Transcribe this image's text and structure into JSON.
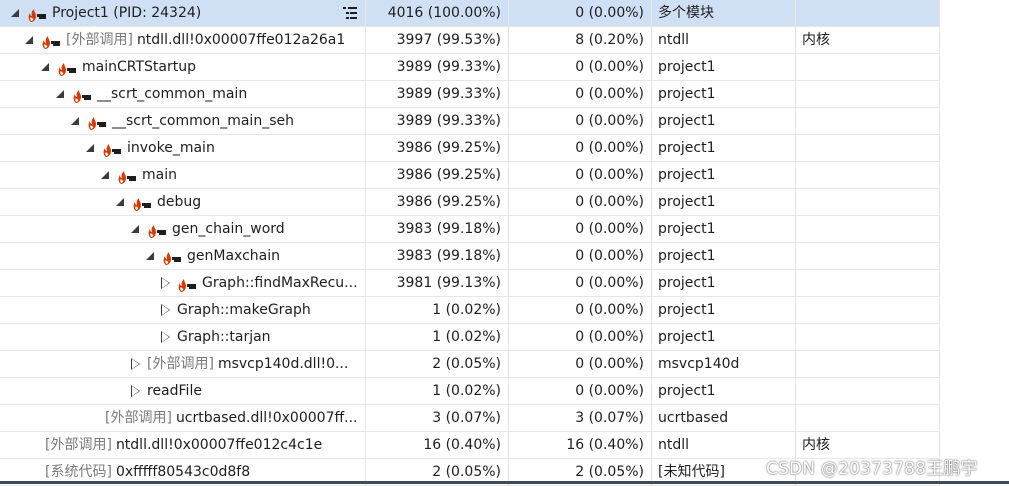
{
  "rows": [
    {
      "ext": "",
      "name": "Project1 (PID: 24324)",
      "total": "4016 (100.00%)",
      "self": "0 (0.00%)",
      "module": "多个模块",
      "category": ""
    },
    {
      "ext": "[外部调用]",
      "name": "ntdll.dll!0x00007ffe012a26a1",
      "total": "3997 (99.53%)",
      "self": "8 (0.20%)",
      "module": "ntdll",
      "category": "内核"
    },
    {
      "ext": "",
      "name": "mainCRTStartup",
      "total": "3989 (99.33%)",
      "self": "0 (0.00%)",
      "module": "project1",
      "category": ""
    },
    {
      "ext": "",
      "name": "__scrt_common_main",
      "total": "3989 (99.33%)",
      "self": "0 (0.00%)",
      "module": "project1",
      "category": ""
    },
    {
      "ext": "",
      "name": "__scrt_common_main_seh",
      "total": "3989 (99.33%)",
      "self": "0 (0.00%)",
      "module": "project1",
      "category": ""
    },
    {
      "ext": "",
      "name": "invoke_main",
      "total": "3986 (99.25%)",
      "self": "0 (0.00%)",
      "module": "project1",
      "category": ""
    },
    {
      "ext": "",
      "name": "main",
      "total": "3986 (99.25%)",
      "self": "0 (0.00%)",
      "module": "project1",
      "category": ""
    },
    {
      "ext": "",
      "name": "debug",
      "total": "3986 (99.25%)",
      "self": "0 (0.00%)",
      "module": "project1",
      "category": ""
    },
    {
      "ext": "",
      "name": "gen_chain_word",
      "total": "3983 (99.18%)",
      "self": "0 (0.00%)",
      "module": "project1",
      "category": ""
    },
    {
      "ext": "",
      "name": "genMaxchain",
      "total": "3983 (99.18%)",
      "self": "0 (0.00%)",
      "module": "project1",
      "category": ""
    },
    {
      "ext": "",
      "name": "Graph::findMaxRecu...",
      "total": "3981 (99.13%)",
      "self": "0 (0.00%)",
      "module": "project1",
      "category": ""
    },
    {
      "ext": "",
      "name": "Graph::makeGraph",
      "total": "1 (0.02%)",
      "self": "0 (0.00%)",
      "module": "project1",
      "category": ""
    },
    {
      "ext": "",
      "name": "Graph::tarjan",
      "total": "1 (0.02%)",
      "self": "0 (0.00%)",
      "module": "project1",
      "category": ""
    },
    {
      "ext": "[外部调用]",
      "name": "msvcp140d.dll!0...",
      "total": "2 (0.05%)",
      "self": "0 (0.00%)",
      "module": "msvcp140d",
      "category": ""
    },
    {
      "ext": "",
      "name": "readFile",
      "total": "1 (0.02%)",
      "self": "0 (0.00%)",
      "module": "project1",
      "category": ""
    },
    {
      "ext": "[外部调用]",
      "name": "ucrtbased.dll!0x00007ff...",
      "total": "3 (0.07%)",
      "self": "3 (0.07%)",
      "module": "ucrtbased",
      "category": ""
    },
    {
      "ext": "[外部调用]",
      "name": "ntdll.dll!0x00007ffe012c4c1e",
      "total": "16 (0.40%)",
      "self": "16 (0.40%)",
      "module": "ntdll",
      "category": "内核"
    },
    {
      "ext": "[系统代码]",
      "name": "0xfffff80543c0d8f8",
      "total": "2 (0.05%)",
      "self": "2 (0.05%)",
      "module": "[未知代码]",
      "category": ""
    }
  ],
  "watermark": "CSDN @20373788王鹏宇",
  "colors": {
    "selected_row": "#cfe0f5",
    "hot_path_flame": "#d83b01",
    "external_text": "#7a7a7a"
  },
  "icons": {
    "hot_path": "hot-path-flame-icon",
    "expand": "expand-arrow-icon",
    "collapse": "collapse-arrow-icon",
    "header_menu": "list-options-icon"
  }
}
